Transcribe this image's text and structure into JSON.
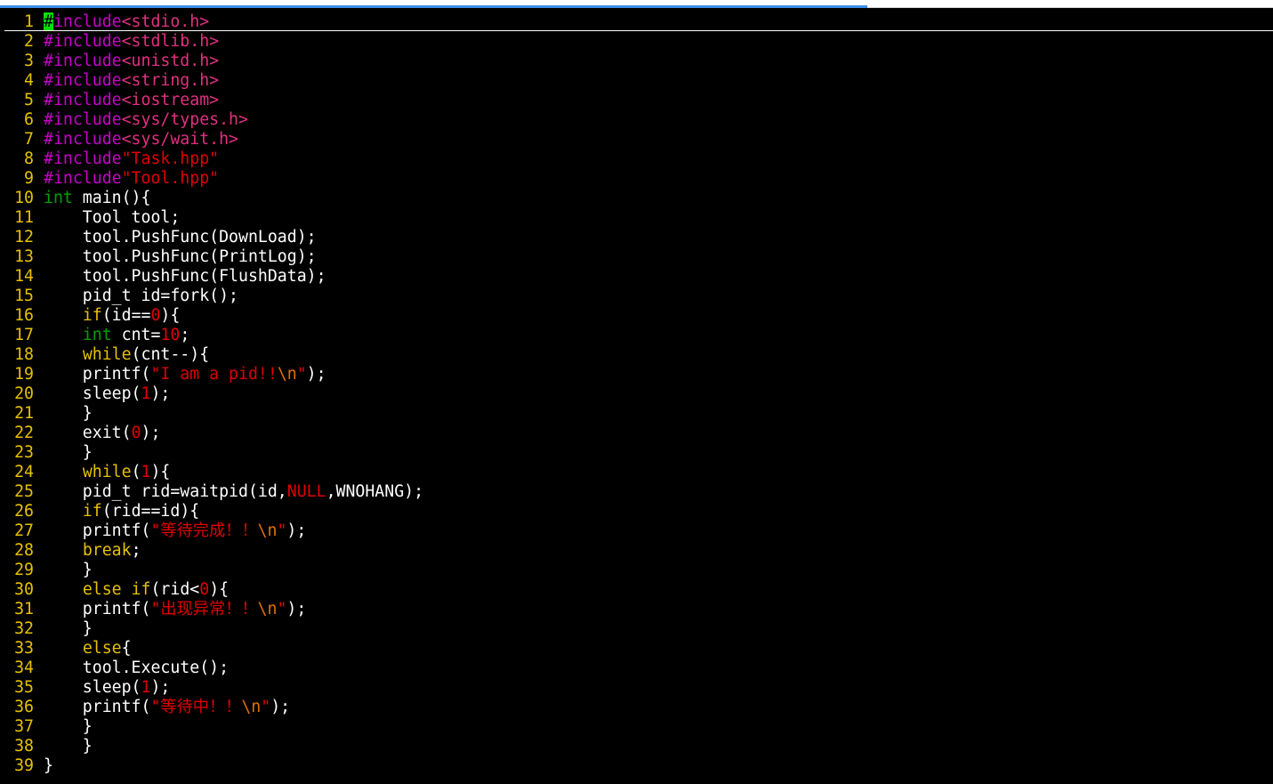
{
  "colors": {
    "background": "#000000",
    "line_number": "#e6c100",
    "preprocessor": "#c800c8",
    "include_path": "#e03080",
    "string": "#e00000",
    "type": "#00a000",
    "keyword": "#e6c100",
    "number": "#e00000",
    "escape": "#e07000",
    "cursor": "#00e000"
  },
  "lines": [
    {
      "n": "1",
      "tokens": [
        {
          "t": "#",
          "c": "cursor"
        },
        {
          "t": "include",
          "c": "pp"
        },
        {
          "t": "<stdio.h>",
          "c": "inc"
        }
      ]
    },
    {
      "n": "2",
      "tokens": [
        {
          "t": "#include",
          "c": "pp"
        },
        {
          "t": "<stdlib.h>",
          "c": "inc"
        }
      ]
    },
    {
      "n": "3",
      "tokens": [
        {
          "t": "#include",
          "c": "pp"
        },
        {
          "t": "<unistd.h>",
          "c": "inc"
        }
      ]
    },
    {
      "n": "4",
      "tokens": [
        {
          "t": "#include",
          "c": "pp"
        },
        {
          "t": "<string.h>",
          "c": "inc"
        }
      ]
    },
    {
      "n": "5",
      "tokens": [
        {
          "t": "#include",
          "c": "pp"
        },
        {
          "t": "<iostream>",
          "c": "inc"
        }
      ]
    },
    {
      "n": "6",
      "tokens": [
        {
          "t": "#include",
          "c": "pp"
        },
        {
          "t": "<sys/types.h>",
          "c": "inc"
        }
      ]
    },
    {
      "n": "7",
      "tokens": [
        {
          "t": "#include",
          "c": "pp"
        },
        {
          "t": "<sys/wait.h>",
          "c": "inc"
        }
      ]
    },
    {
      "n": "8",
      "tokens": [
        {
          "t": "#include",
          "c": "pp"
        },
        {
          "t": "\"Task.hpp\"",
          "c": "str"
        }
      ]
    },
    {
      "n": "9",
      "tokens": [
        {
          "t": "#include",
          "c": "pp"
        },
        {
          "t": "\"Tool.hpp\"",
          "c": "str"
        }
      ]
    },
    {
      "n": "10",
      "tokens": [
        {
          "t": "int",
          "c": "type"
        },
        {
          "t": " main(){",
          "c": "plain"
        }
      ]
    },
    {
      "n": "11",
      "tokens": [
        {
          "t": "    Tool tool;",
          "c": "plain"
        }
      ]
    },
    {
      "n": "12",
      "tokens": [
        {
          "t": "    tool.PushFunc(DownLoad);",
          "c": "plain"
        }
      ]
    },
    {
      "n": "13",
      "tokens": [
        {
          "t": "    tool.PushFunc(PrintLog);",
          "c": "plain"
        }
      ]
    },
    {
      "n": "14",
      "tokens": [
        {
          "t": "    tool.PushFunc(FlushData);",
          "c": "plain"
        }
      ]
    },
    {
      "n": "15",
      "tokens": [
        {
          "t": "    pid_t id=fork();",
          "c": "plain"
        }
      ]
    },
    {
      "n": "16",
      "tokens": [
        {
          "t": "    ",
          "c": "plain"
        },
        {
          "t": "if",
          "c": "kw"
        },
        {
          "t": "(id==",
          "c": "plain"
        },
        {
          "t": "0",
          "c": "num"
        },
        {
          "t": "){",
          "c": "plain"
        }
      ]
    },
    {
      "n": "17",
      "tokens": [
        {
          "t": "    ",
          "c": "plain"
        },
        {
          "t": "int",
          "c": "type"
        },
        {
          "t": " cnt=",
          "c": "plain"
        },
        {
          "t": "10",
          "c": "num"
        },
        {
          "t": ";",
          "c": "plain"
        }
      ]
    },
    {
      "n": "18",
      "tokens": [
        {
          "t": "    ",
          "c": "plain"
        },
        {
          "t": "while",
          "c": "kw"
        },
        {
          "t": "(cnt--){",
          "c": "plain"
        }
      ]
    },
    {
      "n": "19",
      "tokens": [
        {
          "t": "    printf(",
          "c": "plain"
        },
        {
          "t": "\"I am a pid!!",
          "c": "str"
        },
        {
          "t": "\\n",
          "c": "esc"
        },
        {
          "t": "\"",
          "c": "str"
        },
        {
          "t": ");",
          "c": "plain"
        }
      ]
    },
    {
      "n": "20",
      "tokens": [
        {
          "t": "    sleep(",
          "c": "plain"
        },
        {
          "t": "1",
          "c": "num"
        },
        {
          "t": ");",
          "c": "plain"
        }
      ]
    },
    {
      "n": "21",
      "tokens": [
        {
          "t": "    }",
          "c": "plain"
        }
      ]
    },
    {
      "n": "22",
      "tokens": [
        {
          "t": "    exit(",
          "c": "plain"
        },
        {
          "t": "0",
          "c": "num"
        },
        {
          "t": ");",
          "c": "plain"
        }
      ]
    },
    {
      "n": "23",
      "tokens": [
        {
          "t": "    }",
          "c": "plain"
        }
      ]
    },
    {
      "n": "24",
      "tokens": [
        {
          "t": "    ",
          "c": "plain"
        },
        {
          "t": "while",
          "c": "kw"
        },
        {
          "t": "(",
          "c": "plain"
        },
        {
          "t": "1",
          "c": "num"
        },
        {
          "t": "){",
          "c": "plain"
        }
      ]
    },
    {
      "n": "25",
      "tokens": [
        {
          "t": "    pid_t rid=waitpid(id,",
          "c": "plain"
        },
        {
          "t": "NULL",
          "c": "num"
        },
        {
          "t": ",WNOHANG);",
          "c": "plain"
        }
      ]
    },
    {
      "n": "26",
      "tokens": [
        {
          "t": "    ",
          "c": "plain"
        },
        {
          "t": "if",
          "c": "kw"
        },
        {
          "t": "(rid==id){",
          "c": "plain"
        }
      ]
    },
    {
      "n": "27",
      "tokens": [
        {
          "t": "    printf(",
          "c": "plain"
        },
        {
          "t": "\"等待完成！！",
          "c": "str"
        },
        {
          "t": "\\n",
          "c": "esc"
        },
        {
          "t": "\"",
          "c": "str"
        },
        {
          "t": ");",
          "c": "plain"
        }
      ]
    },
    {
      "n": "28",
      "tokens": [
        {
          "t": "    ",
          "c": "plain"
        },
        {
          "t": "break",
          "c": "kw"
        },
        {
          "t": ";",
          "c": "plain"
        }
      ]
    },
    {
      "n": "29",
      "tokens": [
        {
          "t": "    }",
          "c": "plain"
        }
      ]
    },
    {
      "n": "30",
      "tokens": [
        {
          "t": "    ",
          "c": "plain"
        },
        {
          "t": "else",
          "c": "kw"
        },
        {
          "t": " ",
          "c": "plain"
        },
        {
          "t": "if",
          "c": "kw"
        },
        {
          "t": "(rid<",
          "c": "plain"
        },
        {
          "t": "0",
          "c": "num"
        },
        {
          "t": "){",
          "c": "plain"
        }
      ]
    },
    {
      "n": "31",
      "tokens": [
        {
          "t": "    printf(",
          "c": "plain"
        },
        {
          "t": "\"出现异常！！",
          "c": "str"
        },
        {
          "t": "\\n",
          "c": "esc"
        },
        {
          "t": "\"",
          "c": "str"
        },
        {
          "t": ");",
          "c": "plain"
        }
      ]
    },
    {
      "n": "32",
      "tokens": [
        {
          "t": "    }",
          "c": "plain"
        }
      ]
    },
    {
      "n": "33",
      "tokens": [
        {
          "t": "    ",
          "c": "plain"
        },
        {
          "t": "else",
          "c": "kw"
        },
        {
          "t": "{",
          "c": "plain"
        }
      ]
    },
    {
      "n": "34",
      "tokens": [
        {
          "t": "    tool.Execute();",
          "c": "plain"
        }
      ]
    },
    {
      "n": "35",
      "tokens": [
        {
          "t": "    sleep(",
          "c": "plain"
        },
        {
          "t": "1",
          "c": "num"
        },
        {
          "t": ");",
          "c": "plain"
        }
      ]
    },
    {
      "n": "36",
      "tokens": [
        {
          "t": "    printf(",
          "c": "plain"
        },
        {
          "t": "\"等待中！！",
          "c": "str"
        },
        {
          "t": "\\n",
          "c": "esc"
        },
        {
          "t": "\"",
          "c": "str"
        },
        {
          "t": ");",
          "c": "plain"
        }
      ]
    },
    {
      "n": "37",
      "tokens": [
        {
          "t": "    }",
          "c": "plain"
        }
      ]
    },
    {
      "n": "38",
      "tokens": [
        {
          "t": "    }",
          "c": "plain"
        }
      ]
    },
    {
      "n": "39",
      "tokens": [
        {
          "t": "}",
          "c": "plain"
        }
      ]
    }
  ]
}
